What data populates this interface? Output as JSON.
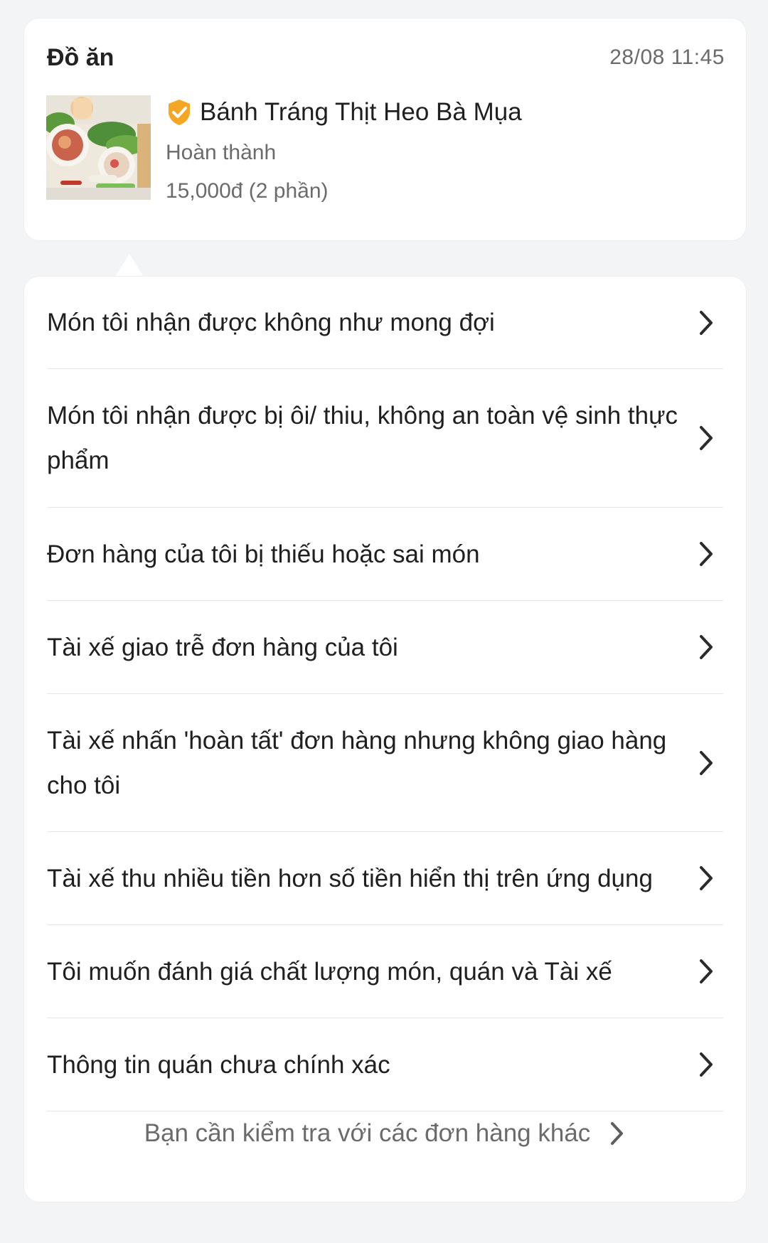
{
  "order": {
    "category": "Đồ ăn",
    "datetime": "28/08 11:45",
    "store_name": "Bánh Tráng Thịt Heo Bà Mụa",
    "status": "Hoàn thành",
    "price": "15,000đ (2 phần)",
    "thumbnail_icon": "food-photo",
    "verified_icon": "verified-shield-icon"
  },
  "issues": [
    {
      "label": "Món tôi nhận được không như mong đợi"
    },
    {
      "label": "Món tôi nhận được bị ôi/ thiu, không an toàn vệ sinh thực phẩm"
    },
    {
      "label": "Đơn hàng của tôi bị thiếu hoặc sai món"
    },
    {
      "label": "Tài xế giao trễ đơn hàng của tôi"
    },
    {
      "label": "Tài xế nhấn 'hoàn tất' đơn hàng nhưng không giao hàng cho tôi"
    },
    {
      "label": "Tài xế thu nhiều tiền hơn số tiền hiển thị trên ứng dụng"
    },
    {
      "label": "Tôi muốn đánh giá chất lượng món, quán và Tài xế"
    },
    {
      "label": "Thông tin quán chưa chính xác"
    }
  ],
  "footer": {
    "other_orders_label": "Bạn cần kiểm tra với các đơn hàng khác"
  },
  "colors": {
    "background": "#f3f4f6",
    "card": "#ffffff",
    "verified_badge": "#f5a623",
    "primary_text": "#1f1f1f",
    "secondary_text": "#6b6b6b"
  }
}
